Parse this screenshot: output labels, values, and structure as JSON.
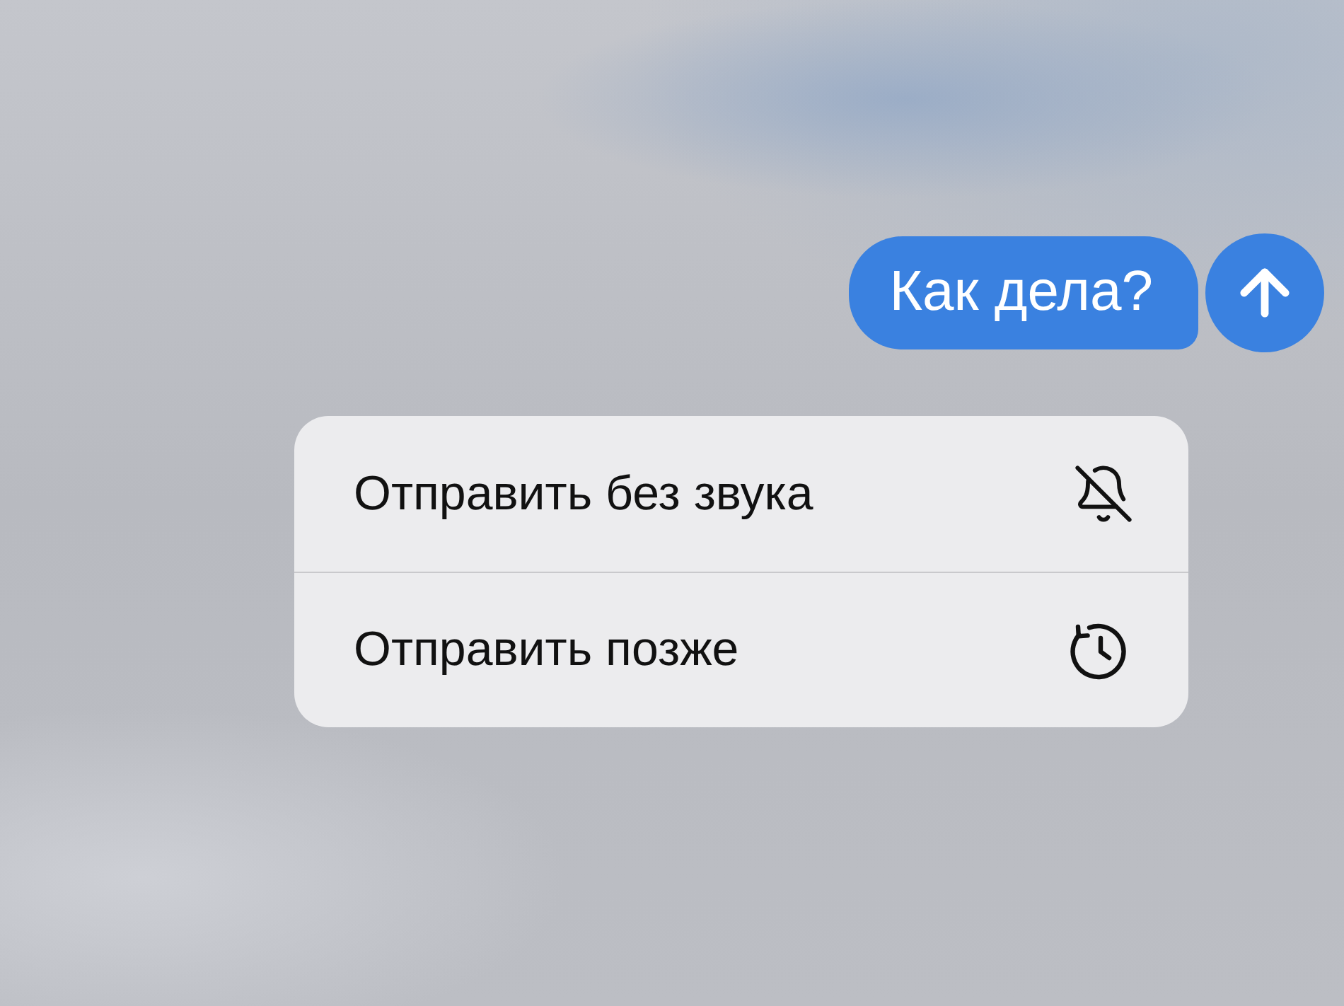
{
  "message": {
    "text": "Как дела?"
  },
  "menu": {
    "items": [
      {
        "label": "Отправить без звука",
        "kind": "mute"
      },
      {
        "label": "Отправить позже",
        "kind": "schedule"
      }
    ]
  }
}
